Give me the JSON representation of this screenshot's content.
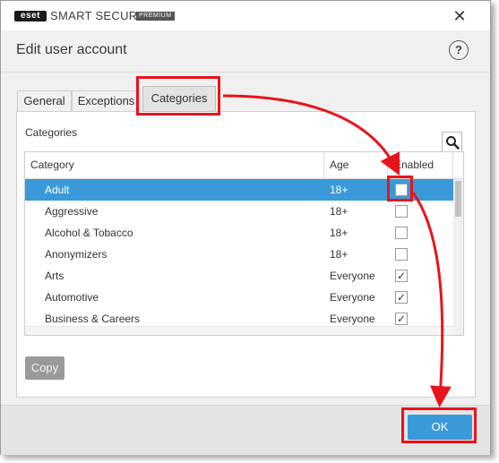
{
  "titlebar": {
    "logo_text": "eset",
    "product_name": "SMART SECURITY",
    "edition": "PREMIUM",
    "close_glyph": "✕"
  },
  "header": {
    "title": "Edit user account",
    "help_glyph": "?"
  },
  "tabs": [
    {
      "label": "General"
    },
    {
      "label": "Exceptions"
    },
    {
      "label": "Categories",
      "active": true
    }
  ],
  "panel": {
    "section_label": "Categories",
    "search_icon": "search-icon"
  },
  "table": {
    "columns": {
      "category": "Category",
      "age": "Age",
      "enabled": "Enabled"
    },
    "rows": [
      {
        "name": "Adult",
        "age": "18+",
        "enabled": false,
        "selected": true
      },
      {
        "name": "Aggressive",
        "age": "18+",
        "enabled": false
      },
      {
        "name": "Alcohol & Tobacco",
        "age": "18+",
        "enabled": false
      },
      {
        "name": "Anonymizers",
        "age": "18+",
        "enabled": false
      },
      {
        "name": "Arts",
        "age": "Everyone",
        "enabled": true
      },
      {
        "name": "Automotive",
        "age": "Everyone",
        "enabled": true
      },
      {
        "name": "Business & Careers",
        "age": "Everyone",
        "enabled": true
      }
    ]
  },
  "buttons": {
    "copy": "Copy",
    "ok": "OK"
  },
  "colors": {
    "accent": "#3a9ad9",
    "annotation": "#e8141b",
    "disabled_button": "#9a9a9a"
  }
}
